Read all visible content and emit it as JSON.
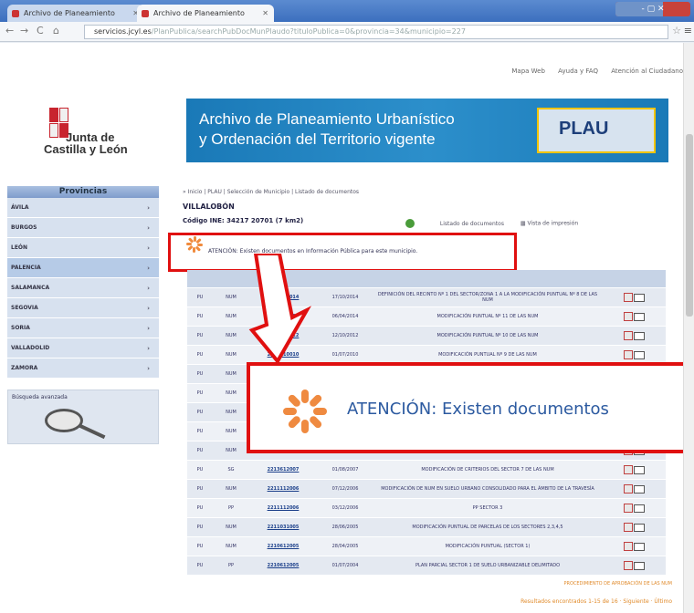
{
  "browser": {
    "tabs": [
      {
        "label": "Archivo de Planeamiento"
      },
      {
        "label": "Archivo de Planeamiento"
      }
    ],
    "url_host": "servicios.jcyl.es",
    "url_path": "/PlanPublica/searchPubDocMunPlaudo?tituloPublica=0&provincia=34&municipio=227",
    "window_controls": "- ▢ ✕"
  },
  "toplinks": [
    "Mapa Web",
    "Ayuda y FAQ",
    "Atención al Ciudadano"
  ],
  "logo": {
    "line1": "Junta de",
    "line2": "Castilla y León"
  },
  "banner": {
    "line1": "Archivo de Planeamiento Urbanístico",
    "line2": "y Ordenación del Territorio vigente",
    "badge": "PLAU"
  },
  "sidebar": {
    "header": "Provincias",
    "items": [
      {
        "label": "ÁVILA"
      },
      {
        "label": "BURGOS"
      },
      {
        "label": "LEÓN"
      },
      {
        "label": "PALENCIA"
      },
      {
        "label": "SALAMANCA"
      },
      {
        "label": "SEGOVIA"
      },
      {
        "label": "SORIA"
      },
      {
        "label": "VALLADOLID"
      },
      {
        "label": "ZAMORA"
      }
    ],
    "search_title": "Búsqueda avanzada"
  },
  "content": {
    "breadcrumb": "» Inicio | PLAU | Selección de Municipio | Listado de documentos",
    "place": "VILLALOBÓN",
    "codigo": "Código INE: 34217 20701 (7 km2)",
    "tools": [
      "Listado de documentos",
      "Vista de impresión"
    ],
    "warning_small": "ATENCIÓN: Existen documentos en Información Pública para este municipio.",
    "warning_zoom": "ATENCIÓN: Existen documentos",
    "table_header": [
      "",
      "",
      "",
      "",
      "",
      ""
    ],
    "rows": [
      [
        "PU",
        "NUM",
        "2214810014",
        "17/10/2014",
        "DEFINICIÓN DEL RECINTO Nº 1 DEL SECTOR/ZONA 1 A LA MODIFICACIÓN PUNTUAL Nº 8 DE LAS NUM"
      ],
      [
        "PU",
        "NUM",
        "2217610014",
        "06/04/2014",
        "MODIFICACIÓN PUNTUAL Nº 11 DE LAS NUM"
      ],
      [
        "PU",
        "NUM",
        "2216310012",
        "12/10/2012",
        "MODIFICACIÓN PUNTUAL Nº 10 DE LAS NUM"
      ],
      [
        "PU",
        "NUM",
        "2211110010",
        "01/07/2010",
        "MODIFICACIÓN PUNTUAL Nº 9 DE LAS NUM"
      ],
      [
        "PU",
        "NUM",
        "",
        "",
        ""
      ],
      [
        "PU",
        "NUM",
        "",
        "",
        ""
      ],
      [
        "PU",
        "NUM",
        "",
        "",
        ""
      ],
      [
        "PU",
        "NUM",
        "",
        "",
        ""
      ],
      [
        "PU",
        "NUM",
        "",
        "",
        ""
      ],
      [
        "PU",
        "SG",
        "2213612007",
        "01/08/2007",
        "MODIFICACIÓN DE CRITERIOS DEL SECTOR 7 DE LAS NUM"
      ],
      [
        "PU",
        "NUM",
        "2211112006",
        "07/12/2006",
        "MODIFICACIÓN DE NUM EN SUELO URBANO CONSOLIDADO PARA EL ÁMBITO DE LA TRAVESÍA"
      ],
      [
        "PU",
        "PP",
        "2211112006",
        "03/12/2006",
        "PP SECTOR 3"
      ],
      [
        "PU",
        "NUM",
        "2211031005",
        "28/06/2005",
        "MODIFICACIÓN PUNTUAL DE PARCELAS DE LOS SECTORES 2,3,4,5"
      ],
      [
        "PU",
        "NUM",
        "2210612005",
        "28/04/2005",
        "MODIFICACIÓN PUNTUAL (SECTOR 1)"
      ],
      [
        "PU",
        "PP",
        "2210612005",
        "01/07/2004",
        "PLAN PARCIAL SECTOR 1 DE SUELO URBANIZABLE DELIMITADO"
      ]
    ],
    "foot_links": "PROCEDIMIENTO DE APROBACIÓN DE LAS NUM",
    "pagination": "Resultados encontrados 1-15 de 16 · Siguiente · Último"
  },
  "colors": {
    "accent": "#1b3f8a",
    "highlight": "#e01010",
    "banner": "#1a79b7"
  }
}
